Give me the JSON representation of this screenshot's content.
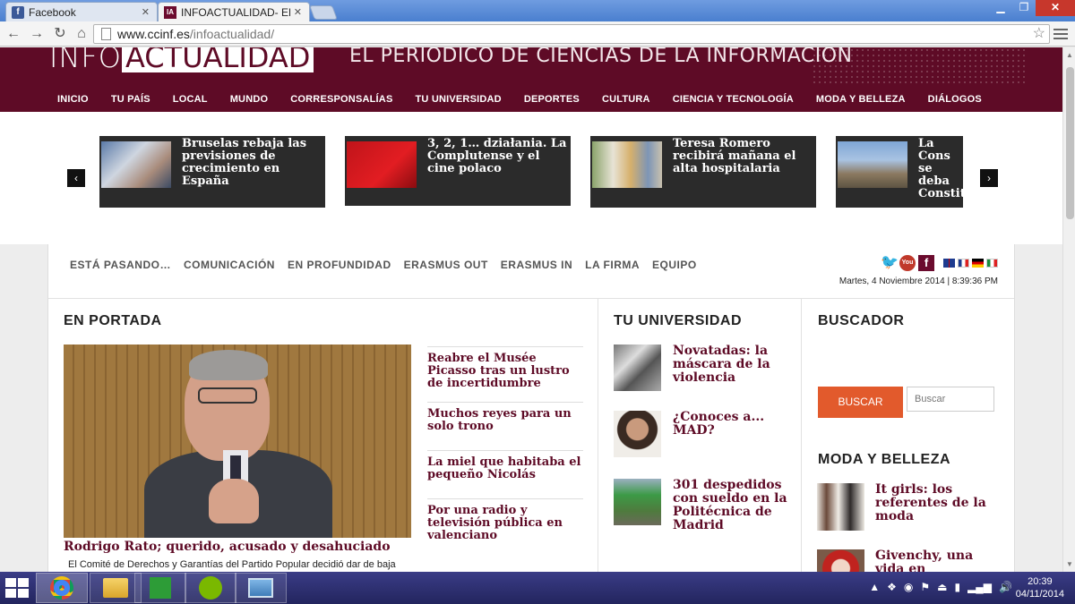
{
  "browser": {
    "tabs": [
      {
        "title": "Facebook",
        "favicon": "facebook-icon",
        "active": false
      },
      {
        "title": "INFOACTUALIDAD- EL PE",
        "favicon": "infoactualidad-icon",
        "active": true
      }
    ],
    "url_domain": "www.ccinf.es",
    "url_path": "/infoactualidad/"
  },
  "site": {
    "logo_part1": "INFO",
    "logo_part2": "ACTUALIDAD",
    "slogan": "EL PERIÓDICO DE CIENCIAS DE LA INFORMACIÓN",
    "main_nav": [
      "INICIO",
      "TU PAÍS",
      "LOCAL",
      "MUNDO",
      "CORRESPONSALÍAS",
      "TU UNIVERSIDAD",
      "DEPORTES",
      "CULTURA",
      "CIENCIA Y TECNOLOGÍA",
      "MODA Y BELLEZA",
      "DIÁLOGOS"
    ]
  },
  "slider": {
    "items": [
      {
        "text": "Bruselas rebaja las previsiones de crecimiento en España"
      },
      {
        "text": "3, 2, 1… działania. La Complutense y el cine polaco"
      },
      {
        "text": "Teresa Romero recibirá mañana el alta hospitalaria"
      },
      {
        "text": "La Cons se deba Constit"
      }
    ],
    "prev": "‹",
    "next": "›"
  },
  "subnav": [
    "ESTÁ PASANDO…",
    "COMUNICACIÓN",
    "EN PROFUNDIDAD",
    "ERASMUS OUT",
    "ERASMUS IN",
    "LA FIRMA",
    "EQUIPO"
  ],
  "social": {
    "youtube": "You Tube",
    "facebook": "f"
  },
  "datetime": "Martes, 4 Noviembre 2014 | 8:39:36 PM",
  "portada": {
    "heading": "EN PORTADA",
    "feature_title": "Rodrigo Rato; querido, acusado y desahuciado",
    "feature_desc": "El Comité de Derechos y Garantías del Partido Popular decidió dar de baja",
    "list": [
      "Reabre el Musée Picasso tras un lustro de incertidumbre",
      "Muchos reyes para un solo trono",
      "La miel que habitaba el pequeño Nicolás",
      "Por una radio y televisión pública en valenciano"
    ]
  },
  "universidad": {
    "heading": "TU UNIVERSIDAD",
    "items": [
      "Novatadas: la máscara de la violencia",
      "¿Conoces a... MAD?",
      "301 despedidos con sueldo en la Politécnica de Madrid"
    ]
  },
  "buscador": {
    "heading": "BUSCADOR",
    "button": "BUSCAR",
    "placeholder": "Buscar"
  },
  "moda": {
    "heading": "MODA Y BELLEZA",
    "items": [
      "It girls: los referentes de la moda",
      "Givenchy, una vida en exposición"
    ]
  },
  "taskbar": {
    "time": "20:39",
    "date": "04/11/2014"
  },
  "colors": {
    "brand": "#5e0b26",
    "accent": "#e25a2c"
  }
}
